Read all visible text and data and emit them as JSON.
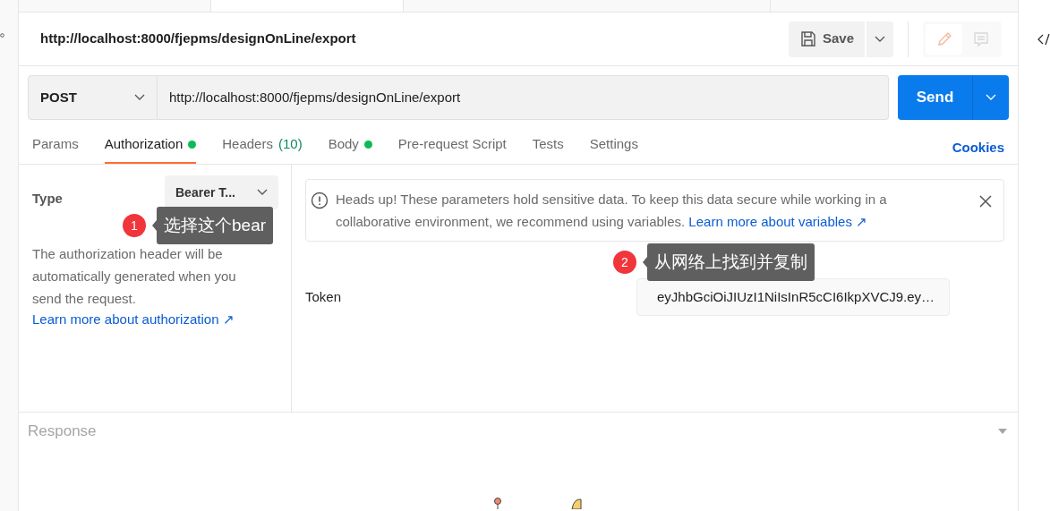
{
  "request_title": "http://localhost:8000/fjepms/designOnLine/export",
  "save": {
    "label": "Save"
  },
  "method": "POST",
  "url": "http://localhost:8000/fjepms/designOnLine/export",
  "send": {
    "label": "Send"
  },
  "modes": [
    {
      "kind": "edit",
      "selected": true
    },
    {
      "kind": "comment",
      "selected": false
    }
  ],
  "tabs": [
    {
      "label": "Params",
      "selected": false,
      "dot": false
    },
    {
      "label": "Authorization",
      "selected": true,
      "dot": true
    },
    {
      "label": "Headers",
      "count": "(10)",
      "selected": false,
      "dot": false
    },
    {
      "label": "Body",
      "selected": false,
      "dot": true
    },
    {
      "label": "Pre-request Script",
      "selected": false,
      "dot": false
    },
    {
      "label": "Tests",
      "selected": false,
      "dot": false
    },
    {
      "label": "Settings",
      "selected": false,
      "dot": false
    }
  ],
  "cookies": "Cookies",
  "auth": {
    "type_label": "Type",
    "type_value": "Bearer T...",
    "description": "The authorization header will be automatically generated when you send the request.",
    "link": "Learn more about authorization ↗"
  },
  "notice": {
    "text": "Heads up! These parameters hold sensitive data. To keep this data secure while working in a collaborative environment, we recommend using variables.",
    "link": "Learn more about variables ↗"
  },
  "token": {
    "label": "Token",
    "value": "eyJhbGciOiJIUzI1NiIsInR5cCI6IkpXVCJ9.ey…"
  },
  "annotations": [
    {
      "number": "1",
      "text": "选择这个bear"
    },
    {
      "number": "2",
      "text": "从网络上找到并复制"
    }
  ],
  "response": {
    "title": "Response"
  }
}
